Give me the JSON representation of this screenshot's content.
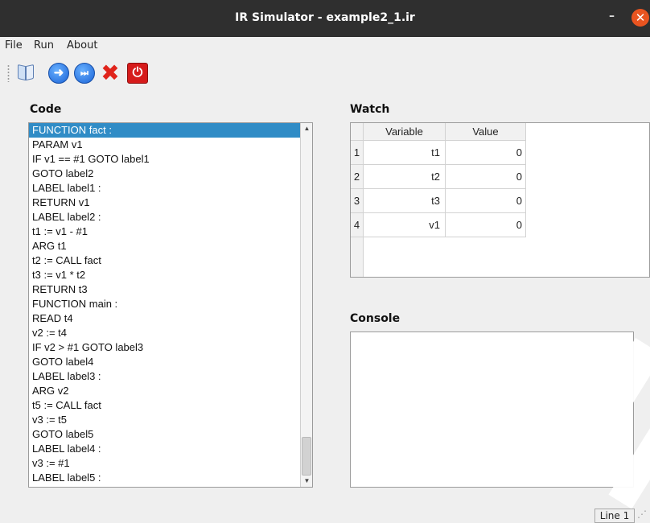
{
  "window": {
    "title": "IR Simulator - example2_1.ir",
    "minimize_glyph": "–",
    "close_glyph": "✕"
  },
  "menu": {
    "file": "File",
    "run": "Run",
    "about": "About"
  },
  "toolbar": {
    "icons": [
      "open-book-icon",
      "run-icon",
      "step-icon",
      "stop-icon",
      "power-icon"
    ],
    "run_glyph": "➜",
    "step_glyph": "⏭",
    "stop_glyph": "✖",
    "power_glyph": "⏻"
  },
  "code": {
    "title": "Code",
    "lines": [
      "FUNCTION fact :",
      "PARAM v1",
      "IF v1 == #1 GOTO label1",
      "GOTO label2",
      "LABEL label1 :",
      "RETURN v1",
      "LABEL label2 :",
      "t1 := v1 - #1",
      "ARG t1",
      "t2 := CALL fact",
      "t3 := v1 * t2",
      "RETURN t3",
      "FUNCTION main :",
      "READ t4",
      "v2 := t4",
      "IF v2 > #1 GOTO label3",
      "GOTO label4",
      "LABEL label3 :",
      "ARG v2",
      "t5 := CALL fact",
      "v3 := t5",
      "GOTO label5",
      "LABEL label4 :",
      "v3 := #1",
      "LABEL label5 :"
    ],
    "selected_index": 0,
    "scroll_up_glyph": "▲",
    "scroll_down_glyph": "▼"
  },
  "watch": {
    "title": "Watch",
    "columns": [
      "Variable",
      "Value"
    ],
    "rows": [
      {
        "index": "1",
        "variable": "t1",
        "value": "0"
      },
      {
        "index": "2",
        "variable": "t2",
        "value": "0"
      },
      {
        "index": "3",
        "variable": "t3",
        "value": "0"
      },
      {
        "index": "4",
        "variable": "v1",
        "value": "0"
      }
    ]
  },
  "console": {
    "title": "Console"
  },
  "status": {
    "line": "Line 1"
  },
  "colors": {
    "titlebar": "#2f2f2f",
    "close_button": "#e95420",
    "selection": "#308cc6"
  }
}
